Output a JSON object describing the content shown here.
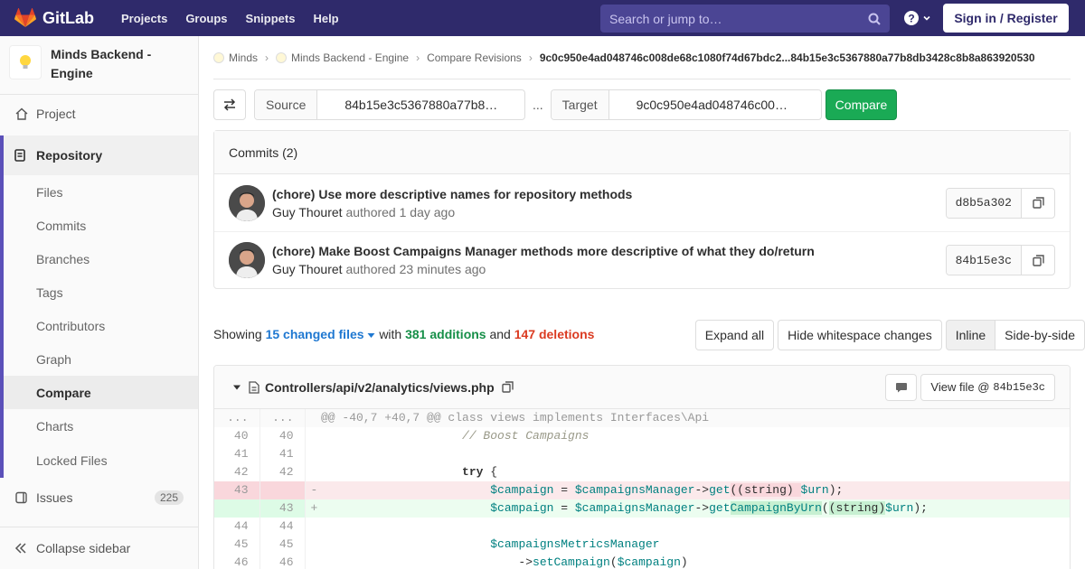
{
  "navbar": {
    "brand": "GitLab",
    "links": [
      "Projects",
      "Groups",
      "Snippets",
      "Help"
    ],
    "search_placeholder": "Search or jump to…",
    "signin": "Sign in / Register"
  },
  "sidebar": {
    "project_name": "Minds Backend - Engine",
    "project": "Project",
    "repository": "Repository",
    "repo_items": [
      "Files",
      "Commits",
      "Branches",
      "Tags",
      "Contributors",
      "Graph",
      "Compare",
      "Charts",
      "Locked Files"
    ],
    "issues": "Issues",
    "issues_count": "225",
    "collapse": "Collapse sidebar"
  },
  "breadcrumbs": {
    "items": [
      "Minds",
      "Minds Backend - Engine",
      "Compare Revisions"
    ],
    "current": "9c0c950e4ad048746c008de68c1080f74d67bdc2...84b15e3c5367880a77b8db3428c8b8a863920530"
  },
  "compare": {
    "source_label": "Source",
    "source_value": "84b15e3c5367880a77b8…",
    "dots": "...",
    "target_label": "Target",
    "target_value": "9c0c950e4ad048746c00…",
    "button": "Compare"
  },
  "commits": {
    "header": "Commits (2)",
    "items": [
      {
        "title": "(chore) Use more descriptive names for repository methods",
        "author": "Guy Thouret",
        "meta": "authored 1 day ago",
        "sha": "d8b5a302"
      },
      {
        "title": "(chore) Make Boost Campaigns Manager methods more descriptive of what they do/return",
        "author": "Guy Thouret",
        "meta": "authored 23 minutes ago",
        "sha": "84b15e3c"
      }
    ]
  },
  "stats": {
    "showing": "Showing",
    "changed": "15 changed files",
    "with": "with",
    "additions": "381 additions",
    "and": "and",
    "deletions": "147 deletions"
  },
  "diff_buttons": {
    "expand": "Expand all",
    "whitespace": "Hide whitespace changes",
    "inline": "Inline",
    "side": "Side-by-side"
  },
  "file": {
    "path": "Controllers/api/v2/analytics/views.php",
    "view_file": "View file @",
    "view_sha": "84b15e3c",
    "hunk": "@@ -40,7 +40,7 @@ class views implements Interfaces\\Api"
  },
  "colors": {
    "navbar": "#2f2a6b",
    "compare_button": "#1aaa55",
    "additions": "#168f48",
    "deletions": "#db3b21",
    "link": "#1f78d1"
  }
}
